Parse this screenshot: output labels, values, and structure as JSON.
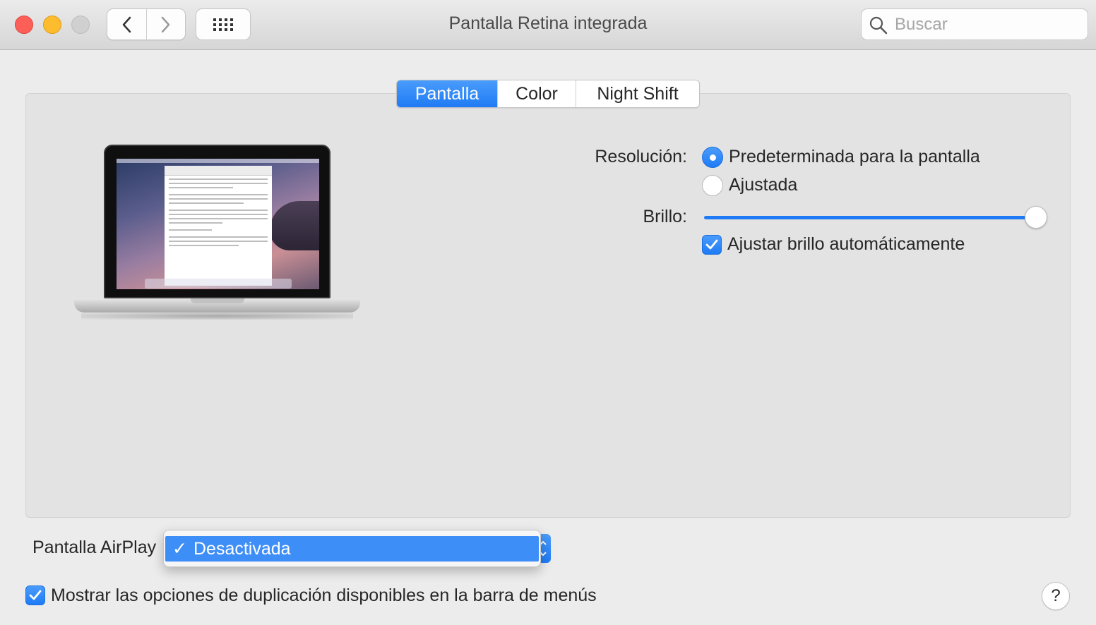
{
  "window": {
    "title": "Pantalla Retina integrada",
    "search_placeholder": "Buscar"
  },
  "toolbar": {
    "icons": [
      "close-icon",
      "minimize-icon",
      "zoom-icon",
      "chevron-left-icon",
      "chevron-right-icon",
      "grid-icon",
      "search-icon"
    ]
  },
  "tabs": [
    {
      "label": "Pantalla",
      "active": true
    },
    {
      "label": "Color",
      "active": false
    },
    {
      "label": "Night Shift",
      "active": false
    }
  ],
  "display": {
    "resolution_label": "Resolución:",
    "resolution_options": [
      {
        "label": "Predeterminada para la pantalla",
        "selected": true
      },
      {
        "label": "Ajustada",
        "selected": false
      }
    ],
    "brightness_label": "Brillo:",
    "brightness_level": 1.0,
    "auto_brightness_label": "Ajustar brillo automáticamente",
    "auto_brightness_checked": true
  },
  "airplay": {
    "label": "Pantalla AirPlay",
    "selected": "Desactivada",
    "check_glyph": "✓"
  },
  "mirror": {
    "label": "Mostrar las opciones de duplicación disponibles en la barra de menús",
    "checked": true
  },
  "help": {
    "glyph": "?"
  },
  "colors": {
    "accent": "#1f7bf5",
    "close": "#fc5f57",
    "minimize": "#fdbc2e",
    "window_bg": "#ececec"
  }
}
